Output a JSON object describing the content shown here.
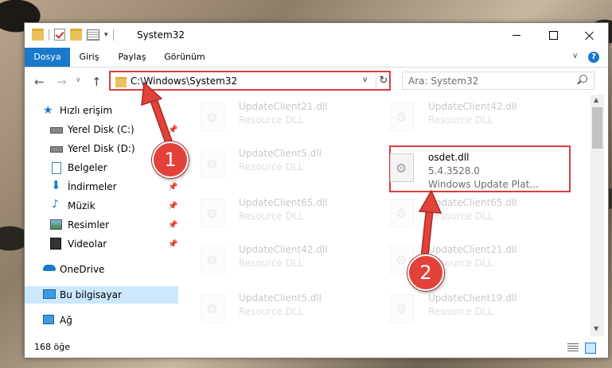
{
  "window": {
    "title": "System32",
    "controls": {
      "minimize": "minimize",
      "maximize": "maximize",
      "close": "close"
    }
  },
  "ribbon": {
    "tabs": [
      {
        "label": "Dosya"
      },
      {
        "label": "Giriş"
      },
      {
        "label": "Paylaş"
      },
      {
        "label": "Görünüm"
      }
    ],
    "help": "?"
  },
  "navigation": {
    "address": "C:\\Windows\\System32",
    "search_placeholder": "Ara: System32"
  },
  "sidebar": {
    "items": [
      {
        "label": "Hızlı erişim",
        "icon": "star-icon"
      },
      {
        "label": "Yerel Disk (C:)",
        "icon": "drive-icon"
      },
      {
        "label": "Yerel Disk (D:)",
        "icon": "drive-icon"
      },
      {
        "label": "Belgeler",
        "icon": "document-icon"
      },
      {
        "label": "İndirmeler",
        "icon": "download-icon"
      },
      {
        "label": "Müzik",
        "icon": "music-icon"
      },
      {
        "label": "Resimler",
        "icon": "pictures-icon"
      },
      {
        "label": "Videolar",
        "icon": "video-icon"
      },
      {
        "label": "OneDrive",
        "icon": "cloud-icon"
      },
      {
        "label": "Bu bilgisayar",
        "icon": "computer-icon"
      },
      {
        "label": "Ağ",
        "icon": "network-icon"
      }
    ]
  },
  "files": {
    "left": [
      {
        "name": "UpdateClient21.dll",
        "desc": "Resource DLL"
      },
      {
        "name": "UpdateClient5.dll",
        "desc": "Resource DLL"
      },
      {
        "name": "UpdateClient65.dll",
        "desc": "Resource DLL"
      },
      {
        "name": "UpdateClient42.dll",
        "desc": "Resource DLL"
      },
      {
        "name": "UpdateClient5.dll",
        "desc": "Resource DLL"
      }
    ],
    "right": [
      {
        "name": "UpdateClient42.dll",
        "desc": "Resource DLL"
      },
      {
        "name": "UpdateClient65.dll",
        "desc": "Resource DLL"
      },
      {
        "name": "UpdateClient21.dll",
        "desc": "Resource DLL"
      },
      {
        "name": "UpdateClient19.dll",
        "desc": "Resource DLL"
      }
    ],
    "highlighted": {
      "name": "osdet.dll",
      "version": "5.4.3528.0",
      "desc": "Windows Update Plat..."
    }
  },
  "status": {
    "item_count": "168 öğe"
  },
  "callouts": [
    {
      "label": "1"
    },
    {
      "label": "2"
    }
  ],
  "colors": {
    "accent": "#1979ca",
    "highlight": "#d83c3c",
    "selection": "#cce8ff"
  }
}
